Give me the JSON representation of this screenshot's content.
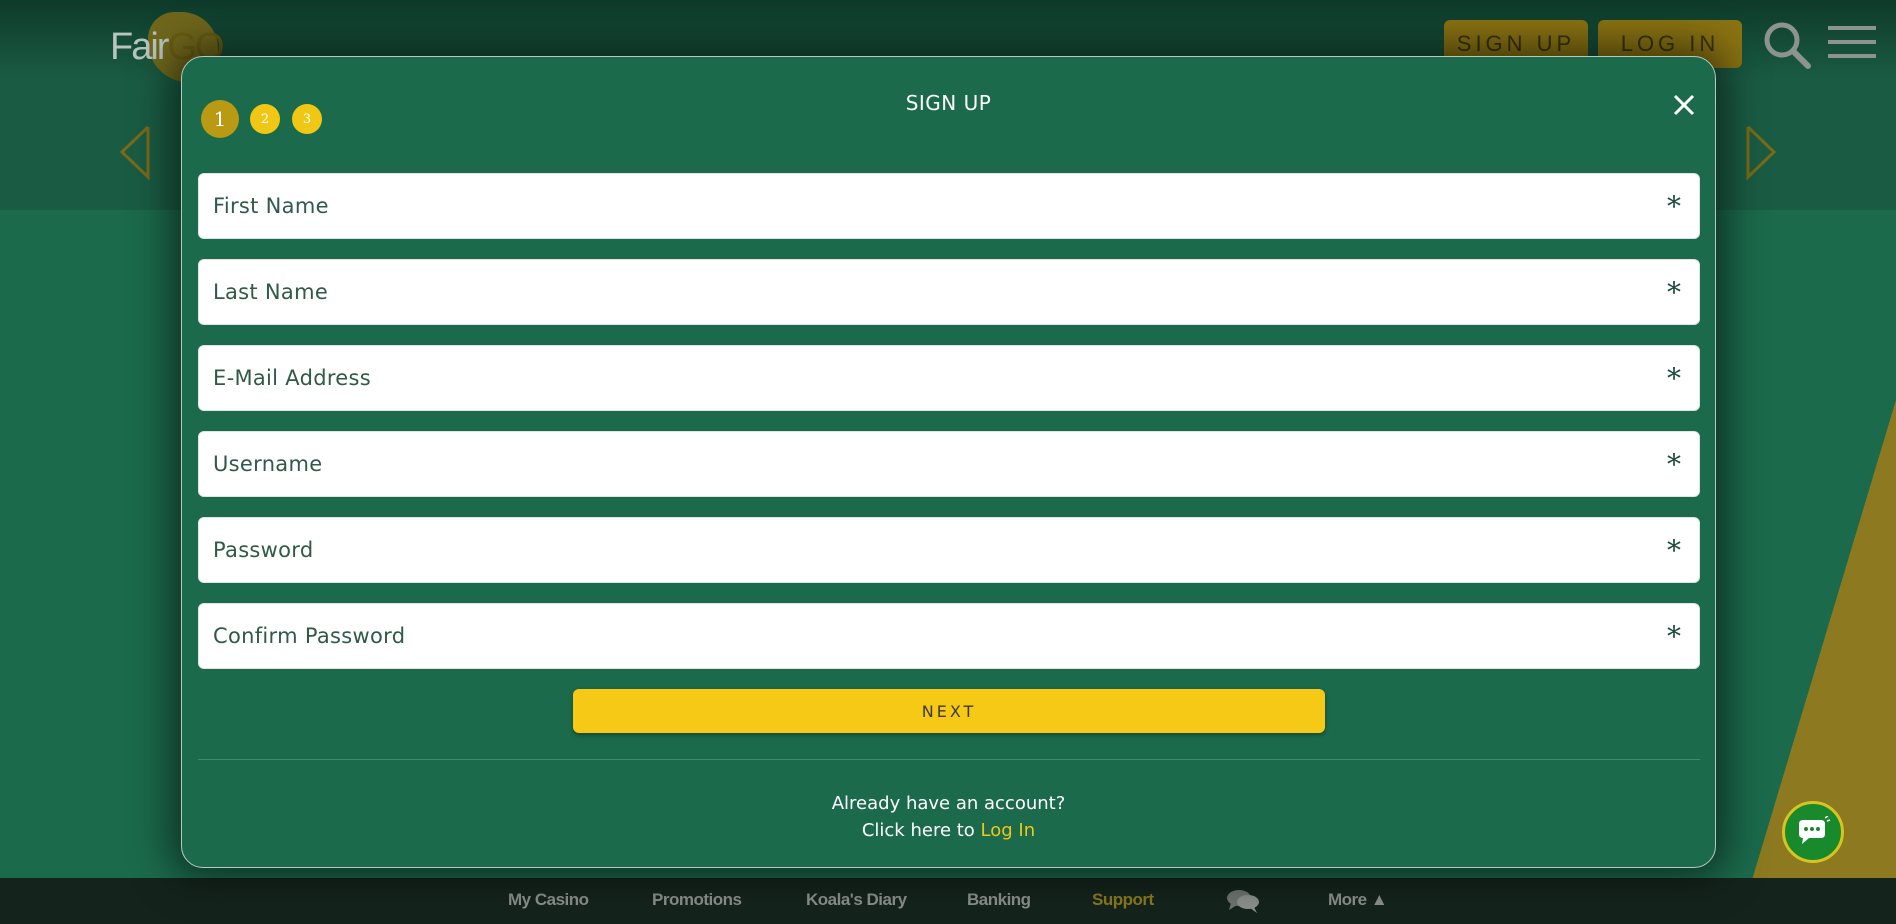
{
  "header": {
    "logo_text": "FairGO Casino",
    "signup_label": "SIGN UP",
    "login_label": "LOG IN"
  },
  "modal": {
    "title": "SIGN UP",
    "steps": [
      "1",
      "2",
      "3"
    ],
    "fields": [
      {
        "placeholder": "First Name",
        "required_mark": "*"
      },
      {
        "placeholder": "Last Name",
        "required_mark": "*"
      },
      {
        "placeholder": "E-Mail Address",
        "required_mark": "*"
      },
      {
        "placeholder": "Username",
        "required_mark": "*"
      },
      {
        "placeholder": "Password",
        "required_mark": "*"
      },
      {
        "placeholder": "Confirm Password",
        "required_mark": "*"
      }
    ],
    "next_label": "NEXT",
    "account_question": "Already have an account?",
    "login_prefix": "Click here to",
    "login_link": "Log In"
  },
  "bottom_nav": {
    "items": [
      "My Casino",
      "Promotions",
      "Koala's Diary",
      "Banking",
      "Support",
      "More ▲"
    ],
    "active": "Support"
  },
  "colors": {
    "brand_green": "#1b6a4c",
    "accent_yellow": "#f6c917",
    "active_nav": "#8d7b1c"
  }
}
